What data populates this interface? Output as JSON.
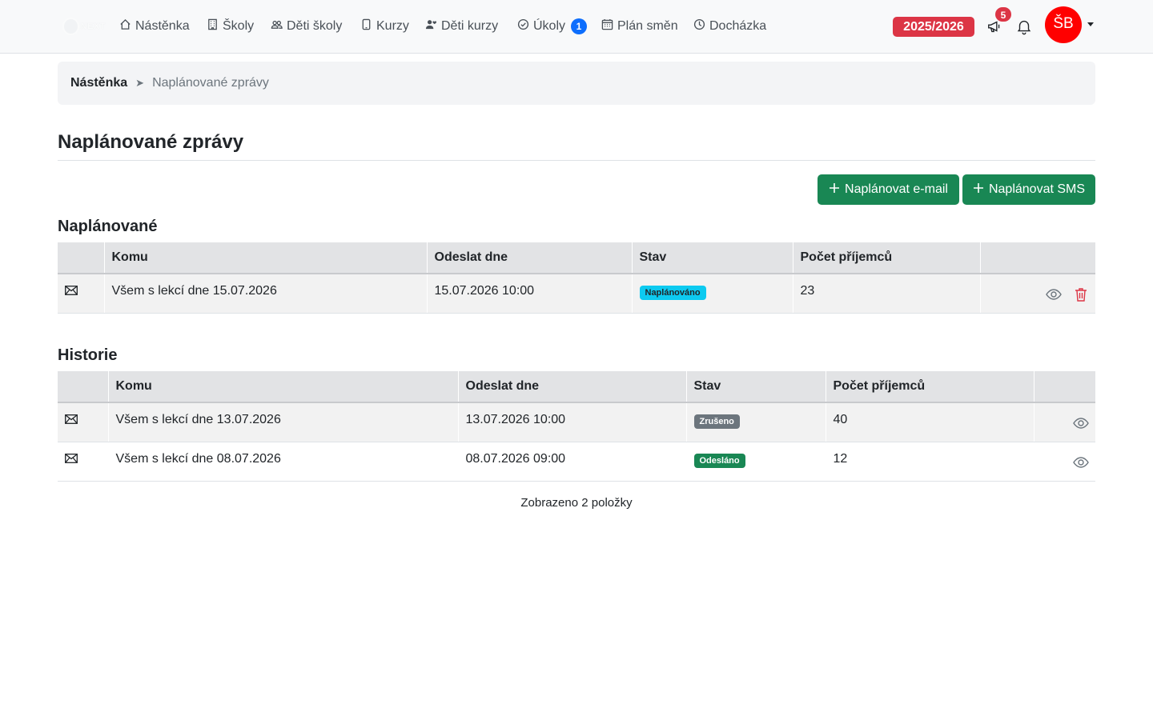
{
  "navbar": {
    "logo_text": "NEXT",
    "items": [
      {
        "label": "Nástěnka"
      },
      {
        "label": "Školy"
      },
      {
        "label": "Děti školy"
      },
      {
        "label": "Kurzy"
      },
      {
        "label": "Děti kurzy"
      },
      {
        "label": "Úkoly",
        "badge": "1"
      },
      {
        "label": "Plán směn"
      },
      {
        "label": "Docházka"
      }
    ],
    "season": "2025/2026",
    "announcements_count": "5",
    "user_initials": "ŠB",
    "colors": {
      "season": "#dc3545",
      "avatar": "#ff0000",
      "badge": "#0d6efd"
    }
  },
  "breadcrumb": {
    "home": "Nástěnka",
    "separator": "➤",
    "current": "Naplánované zprávy"
  },
  "page": {
    "title": "Naplánované zprávy",
    "btn_email": "Naplánovat e-mail",
    "btn_sms": "Naplánovat SMS",
    "btn_color": "#198754"
  },
  "scheduled": {
    "title": "Naplánované",
    "columns": [
      "",
      "Komu",
      "Odeslat dne",
      "Stav",
      "Počet příjemců",
      ""
    ],
    "rows": [
      {
        "icon": "envelope-icon",
        "to": "Všem s lekcí dne 15.07.2026",
        "send_at": "15.07.2026 10:00",
        "status": "Naplánováno",
        "status_color": "#0dcaf0",
        "recipients": "23"
      }
    ]
  },
  "history": {
    "title": "Historie",
    "columns": [
      "",
      "Komu",
      "Odeslat dne",
      "Stav",
      "Počet příjemců",
      ""
    ],
    "rows": [
      {
        "icon": "envelope-icon",
        "to": "Všem s lekcí dne 13.07.2026",
        "send_at": "13.07.2026 10:00",
        "status": "Zrušeno",
        "status_color": "#6c757d",
        "recipients": "40"
      },
      {
        "icon": "envelope-icon",
        "to": "Všem s lekcí dne 08.07.2026",
        "send_at": "08.07.2026 09:00",
        "status": "Odesláno",
        "status_color": "#198754",
        "recipients": "12"
      }
    ],
    "footer": "Zobrazeno 2 položky"
  }
}
